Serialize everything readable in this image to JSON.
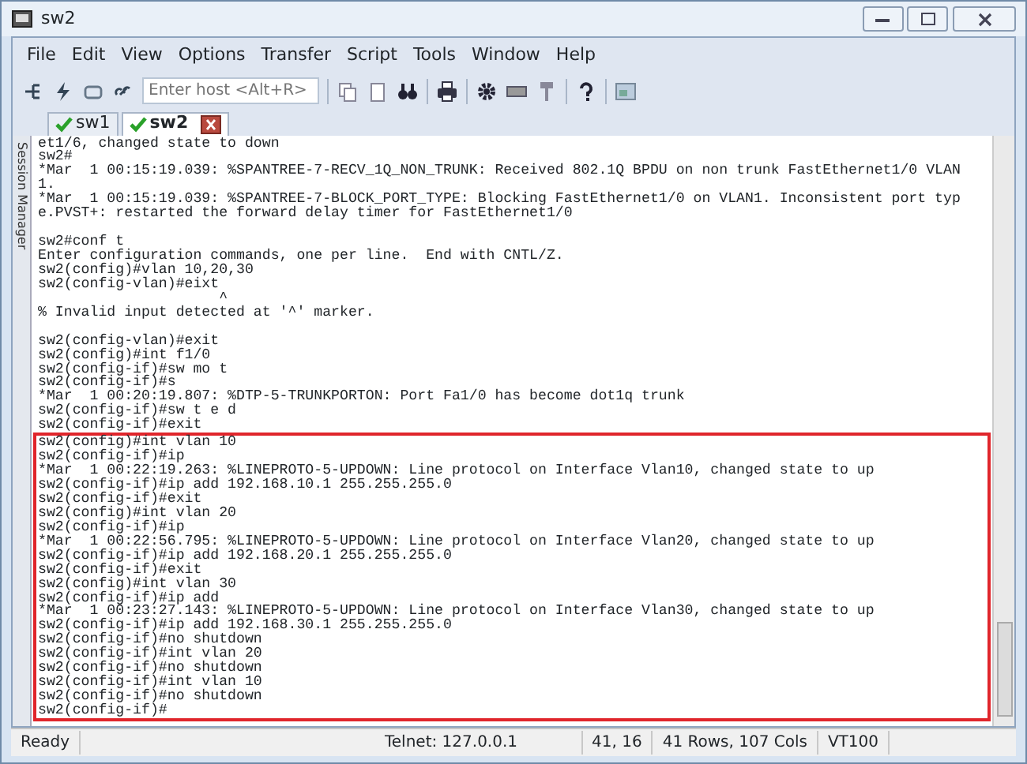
{
  "window": {
    "title": "sw2"
  },
  "menu": [
    "File",
    "Edit",
    "View",
    "Options",
    "Transfer",
    "Script",
    "Tools",
    "Window",
    "Help"
  ],
  "toolbar": {
    "host_placeholder": "Enter host <Alt+R>"
  },
  "tabs": [
    {
      "label": "sw1",
      "selected": false
    },
    {
      "label": "sw2",
      "selected": true
    }
  ],
  "session_manager": {
    "label": "Session Manager"
  },
  "terminal": {
    "blocks": [
      [
        "et1/6, changed state to down",
        "sw2#",
        "*Mar  1 00:15:19.039: %SPANTREE-7-RECV_1Q_NON_TRUNK: Received 802.1Q BPDU on non trunk FastEthernet1/0 VLAN",
        "1.",
        "*Mar  1 00:15:19.039: %SPANTREE-7-BLOCK_PORT_TYPE: Blocking FastEthernet1/0 on VLAN1. Inconsistent port typ",
        "e.PVST+: restarted the forward delay timer for FastEthernet1/0"
      ],
      [
        "sw2#conf t",
        "Enter configuration commands, one per line.  End with CNTL/Z.",
        "sw2(config)#vlan 10,20,30",
        "sw2(config-vlan)#eixt",
        "                     ^",
        "% Invalid input detected at '^' marker."
      ],
      [
        "sw2(config-vlan)#exit",
        "sw2(config)#int f1/0",
        "sw2(config-if)#sw mo t",
        "sw2(config-if)#s",
        "*Mar  1 00:20:19.807: %DTP-5-TRUNKPORTON: Port Fa1/0 has become dot1q trunk",
        "sw2(config-if)#sw t e d",
        "sw2(config-if)#exit"
      ]
    ],
    "highlighted_lines": [
      "sw2(config)#int vlan 10",
      "sw2(config-if)#ip",
      "*Mar  1 00:22:19.263: %LINEPROTO-5-UPDOWN: Line protocol on Interface Vlan10, changed state to up",
      "sw2(config-if)#ip add 192.168.10.1 255.255.255.0",
      "sw2(config-if)#exit",
      "sw2(config)#int vlan 20",
      "sw2(config-if)#ip",
      "*Mar  1 00:22:56.795: %LINEPROTO-5-UPDOWN: Line protocol on Interface Vlan20, changed state to up",
      "sw2(config-if)#ip add 192.168.20.1 255.255.255.0",
      "sw2(config-if)#exit",
      "sw2(config)#int vlan 30",
      "sw2(config-if)#ip add",
      "*Mar  1 00:23:27.143: %LINEPROTO-5-UPDOWN: Line protocol on Interface Vlan30, changed state to up",
      "sw2(config-if)#ip add 192.168.30.1 255.255.255.0",
      "sw2(config-if)#no shutdown",
      "sw2(config-if)#int vlan 20",
      "sw2(config-if)#no shutdown",
      "sw2(config-if)#int vlan 10",
      "sw2(config-if)#no shutdown",
      "sw2(config-if)#"
    ]
  },
  "status_bar": [
    {
      "text": "Ready"
    },
    {
      "text": "Telnet: 127.0.0.1"
    },
    {
      "text": "41,  16"
    },
    {
      "text": "41 Rows, 107 Cols"
    },
    {
      "text": "VT100"
    }
  ]
}
